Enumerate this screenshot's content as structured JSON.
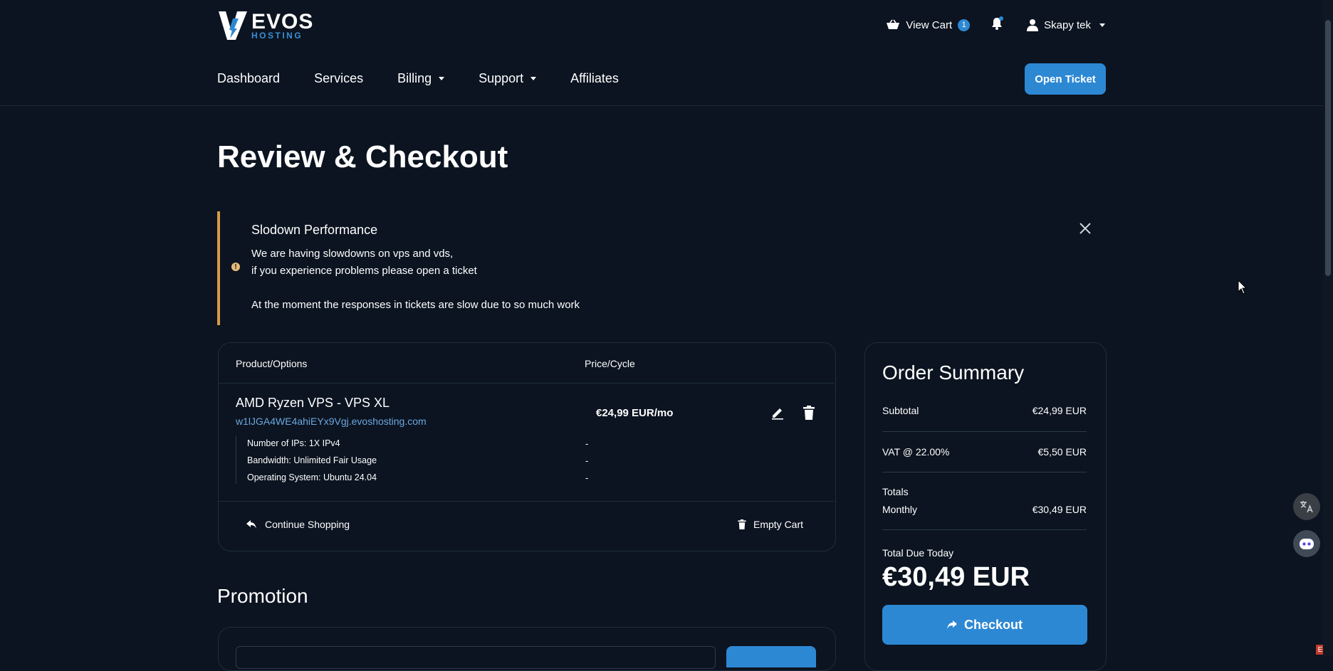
{
  "header": {
    "logo_main": "EVOS",
    "logo_sub": "HOSTING",
    "cart_label": "View Cart",
    "cart_count": "1",
    "user_name": "Skapy tek"
  },
  "nav": {
    "items": [
      "Dashboard",
      "Services",
      "Billing",
      "Support",
      "Affiliates"
    ],
    "open_ticket": "Open Ticket"
  },
  "page": {
    "title": "Review & Checkout"
  },
  "alert": {
    "title": "Slodown Performance",
    "line1": "We are having slowdowns on vps and vds,",
    "line2": "if you experience problems please open a ticket",
    "line3": "At the moment the responses in tickets are slow due to so much work"
  },
  "cart": {
    "col_product": "Product/Options",
    "col_price": "Price/Cycle",
    "product_name": "AMD Ryzen VPS - VPS XL",
    "product_host": "w1lJGA4WE4ahiEYx9Vgj.evoshosting.com",
    "product_price": "€24,99 EUR/mo",
    "options": [
      {
        "label": "Number of IPs: 1X IPv4",
        "value": "-"
      },
      {
        "label": "Bandwidth: Unlimited Fair Usage",
        "value": "-"
      },
      {
        "label": "Operating System: Ubuntu 24.04",
        "value": "-"
      }
    ],
    "continue_shopping": "Continue Shopping",
    "empty_cart": "Empty Cart"
  },
  "promotion": {
    "title": "Promotion"
  },
  "summary": {
    "title": "Order Summary",
    "subtotal_label": "Subtotal",
    "subtotal_value": "€24,99 EUR",
    "vat_label": "VAT @ 22.00%",
    "vat_value": "€5,50 EUR",
    "totals_label": "Totals",
    "monthly_label": "Monthly",
    "monthly_value": "€30,49 EUR",
    "due_label": "Total Due Today",
    "due_amount": "€30,49 EUR",
    "checkout": "Checkout"
  },
  "widgets": {
    "corner_badge": "E"
  },
  "colors": {
    "accent": "#2d88d4",
    "background": "#0b1420",
    "alert_border": "#d89a47"
  }
}
